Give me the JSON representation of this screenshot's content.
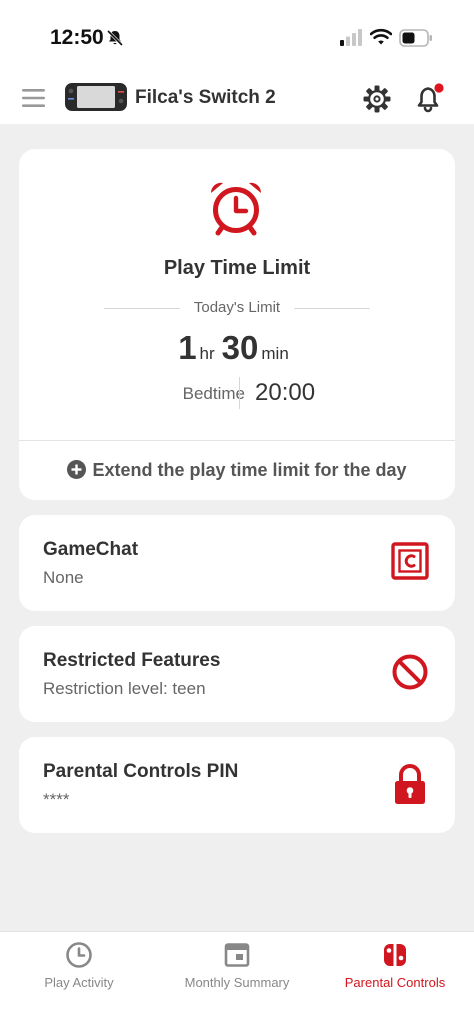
{
  "status_bar": {
    "time": "12:50",
    "icons": [
      "bell-slash-icon",
      "signal-icon",
      "wifi-icon",
      "battery-icon"
    ]
  },
  "header": {
    "menu_icon": "hamburger-icon",
    "device_name": "Filca's Switch 2",
    "settings_icon": "gear-icon",
    "notification_icon": "bell-icon",
    "notification_badge_color": "#e0141e"
  },
  "play_time": {
    "icon": "alarm-clock-icon",
    "title": "Play Time Limit",
    "limit_label": "Today's Limit",
    "hours": "1",
    "hours_unit": "hr",
    "minutes": "30",
    "minutes_unit": "min",
    "bedtime_label": "Bedtime",
    "bedtime_value": "20:00",
    "extend_label": "Extend the play time limit for the day"
  },
  "items": [
    {
      "title": "GameChat",
      "subtitle": "None",
      "icon": "gamechat-icon"
    },
    {
      "title": "Restricted Features",
      "subtitle": "Restriction level: teen",
      "icon": "prohibited-icon"
    },
    {
      "title": "Parental Controls PIN",
      "subtitle": "****",
      "icon": "lock-icon"
    }
  ],
  "bottom_nav": [
    {
      "label": "Play Activity",
      "icon": "clock-icon",
      "active": false
    },
    {
      "label": "Monthly Summary",
      "icon": "calendar-icon",
      "active": false
    },
    {
      "label": "Parental Controls",
      "icon": "switch-icon",
      "active": true
    }
  ],
  "colors": {
    "accent": "#d0161e",
    "background": "#efefef",
    "card": "#ffffff"
  }
}
